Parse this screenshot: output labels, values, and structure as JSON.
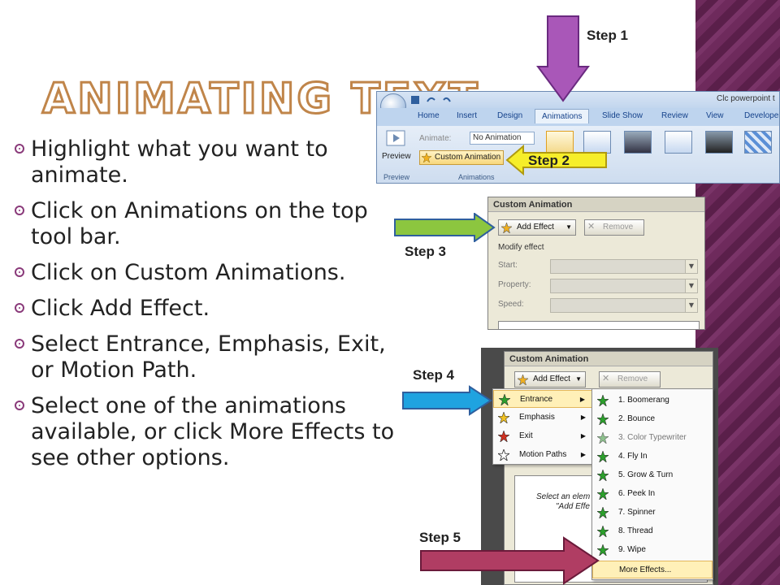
{
  "slide": {
    "title": "Animating Text",
    "bullets": [
      "Highlight what you want to animate.",
      "Click on Animations on the top tool bar.",
      "Click on Custom Animations.",
      "Click Add Effect.",
      "Select Entrance, Emphasis, Exit, or Motion Path.",
      "Select one of the animations available, or click More Effects to see other options."
    ],
    "steps": [
      "Step 1",
      "Step 2",
      "Step 3",
      "Step 4",
      "Step 5"
    ]
  },
  "ribbon": {
    "window_title": "Clc powerpoint t",
    "tabs": [
      "Home",
      "Insert",
      "Design",
      "Animations",
      "Slide Show",
      "Review",
      "View",
      "Developer"
    ],
    "active_tab": "Animations",
    "preview_label": "Preview",
    "preview_group": "Preview",
    "animate_label": "Animate:",
    "animate_value": "No Animation",
    "custom_animation": "Custom Animation",
    "animations_group": "Animations"
  },
  "panel1": {
    "title": "Custom Animation",
    "add_effect": "Add Effect",
    "remove": "Remove",
    "modify_effect": "Modify effect",
    "start": "Start:",
    "property": "Property:",
    "speed": "Speed:"
  },
  "panel2": {
    "title": "Custom Animation",
    "add_effect": "Add Effect",
    "remove": "Remove",
    "menu": [
      "Entrance",
      "Emphasis",
      "Exit",
      "Motion Paths"
    ],
    "submenu": [
      "1. Boomerang",
      "2. Bounce",
      "3. Color Typewriter",
      "4. Fly In",
      "5. Grow & Turn",
      "6. Peek In",
      "7. Spinner",
      "8. Thread",
      "9. Wipe"
    ],
    "more_effects": "More Effects...",
    "hint_line1": "Select an elem",
    "hint_line2": "\"Add Effe"
  },
  "colors": {
    "title_outline": "#c0854a",
    "band": "#6e2a5c",
    "arrow_purple": "#a957b8",
    "arrow_yellow": "#f6ee2a",
    "arrow_green": "#8cc63f",
    "arrow_blue": "#1fa3e0",
    "arrow_magenta": "#b03d63"
  }
}
